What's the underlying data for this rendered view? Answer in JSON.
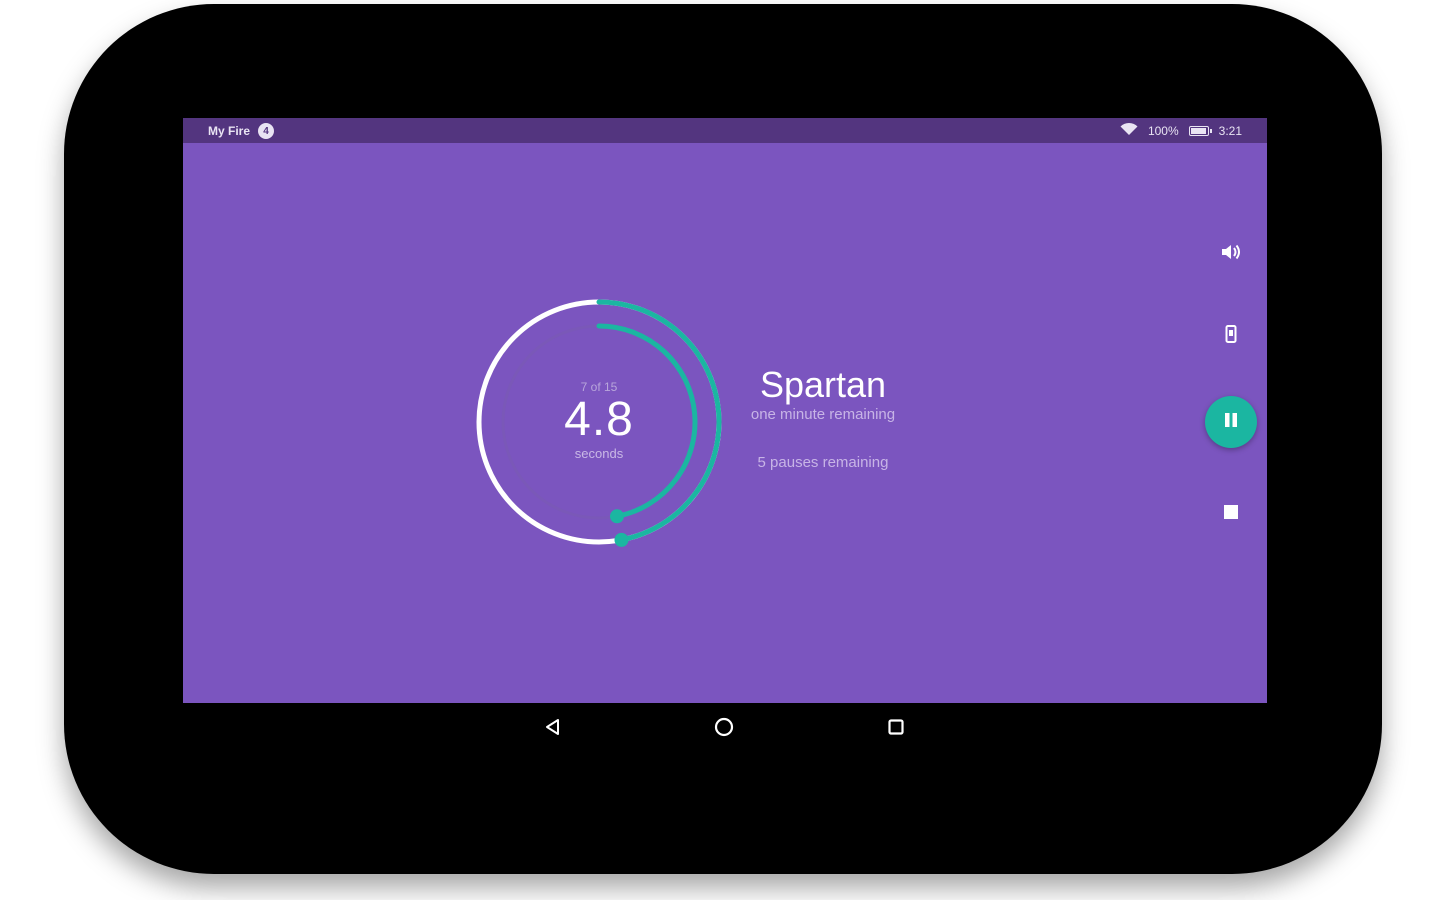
{
  "status_bar": {
    "app_name": "My Fire",
    "notification_count": "4",
    "battery_percent": "100%",
    "battery_level": 1.0,
    "time": "3:21"
  },
  "timer": {
    "round_label": "7 of 15",
    "seconds_value": "4.8",
    "seconds_label": "seconds",
    "interval_progress": 0.47,
    "workout_progress": 0.47
  },
  "workout": {
    "name": "Spartan",
    "time_remaining": "one minute remaining",
    "pauses_remaining": "5 pauses remaining"
  },
  "controls": {
    "volume_icon": "volume-icon",
    "screen_lock_icon": "phone-screen-icon",
    "pause_icon": "pause-icon",
    "stop_icon": "stop-icon"
  },
  "nav": {
    "back_icon": "back-triangle-icon",
    "home_icon": "home-circle-icon",
    "recents_icon": "recents-square-icon"
  },
  "colors": {
    "background": "#7b55bf",
    "status_bar": "#53357f",
    "accent": "#1bb6a1",
    "ring_white": "#ffffff",
    "device_bezel": "#000000"
  }
}
